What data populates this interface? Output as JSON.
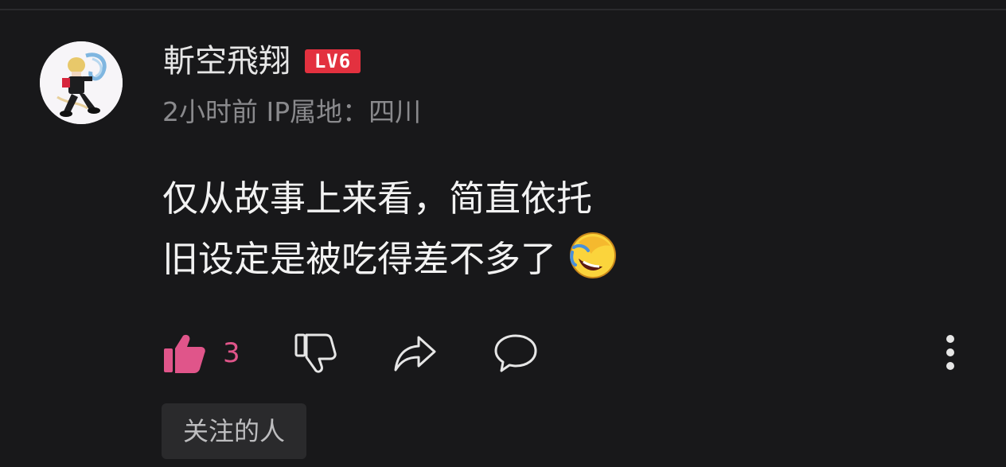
{
  "comment": {
    "username": "斬空飛翔",
    "level_badge": "LV6",
    "meta": "2小时前 IP属地：四川",
    "text_lines": [
      "仅从故事上来看，简直依托",
      "旧设定是被吃得差不多了"
    ],
    "emoji": "laughing-crying-emoji"
  },
  "actions": {
    "like_count": "3",
    "like_icon": "thumbs-up-icon",
    "dislike_icon": "thumbs-down-icon",
    "share_icon": "share-icon",
    "reply_icon": "comment-bubble-icon",
    "more_icon": "more-vertical-icon",
    "like_color": "#e0558a"
  },
  "tag": {
    "label": "关注的人"
  },
  "colors": {
    "background": "#18181a",
    "badge": "#e3313f",
    "muted_text": "#8a8a8d"
  }
}
